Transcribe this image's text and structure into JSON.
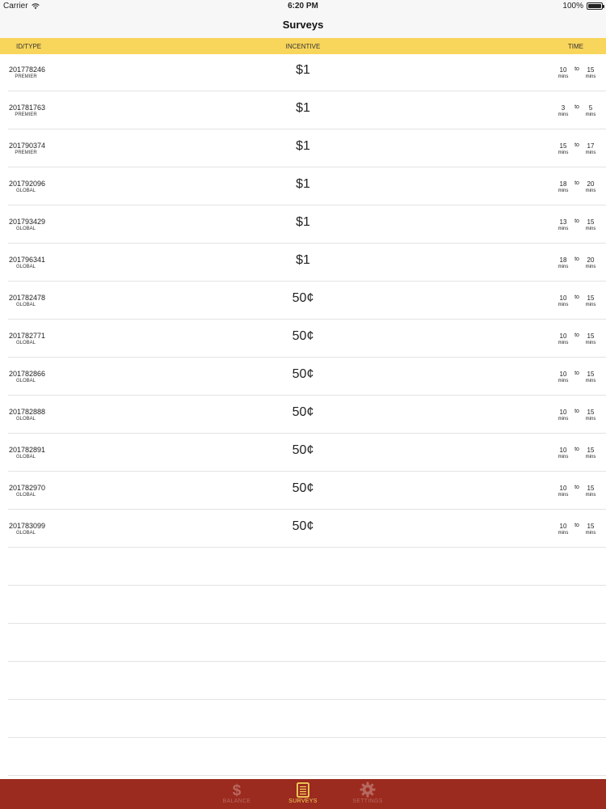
{
  "status_bar": {
    "carrier": "Carrier",
    "time": "6:20 PM",
    "battery": "100%"
  },
  "nav": {
    "title": "Surveys"
  },
  "columns": {
    "id_type": "ID/TYPE",
    "incentive": "INCENTIVE",
    "time": "TIME"
  },
  "surveys": [
    {
      "id": "201778246",
      "type": "PREMIER",
      "incentive": "$1",
      "time_from": "10",
      "time_to": "15",
      "to_label": "to",
      "unit": "mins"
    },
    {
      "id": "201781763",
      "type": "PREMIER",
      "incentive": "$1",
      "time_from": "3",
      "time_to": "5",
      "to_label": "to",
      "unit": "mins"
    },
    {
      "id": "201790374",
      "type": "PREMIER",
      "incentive": "$1",
      "time_from": "15",
      "time_to": "17",
      "to_label": "to",
      "unit": "mins"
    },
    {
      "id": "201792096",
      "type": "GLOBAL",
      "incentive": "$1",
      "time_from": "18",
      "time_to": "20",
      "to_label": "to",
      "unit": "mins"
    },
    {
      "id": "201793429",
      "type": "GLOBAL",
      "incentive": "$1",
      "time_from": "13",
      "time_to": "15",
      "to_label": "to",
      "unit": "mins"
    },
    {
      "id": "201796341",
      "type": "GLOBAL",
      "incentive": "$1",
      "time_from": "18",
      "time_to": "20",
      "to_label": "to",
      "unit": "mins"
    },
    {
      "id": "201782478",
      "type": "GLOBAL",
      "incentive": "50¢",
      "time_from": "10",
      "time_to": "15",
      "to_label": "to",
      "unit": "mins"
    },
    {
      "id": "201782771",
      "type": "GLOBAL",
      "incentive": "50¢",
      "time_from": "10",
      "time_to": "15",
      "to_label": "to",
      "unit": "mins"
    },
    {
      "id": "201782866",
      "type": "GLOBAL",
      "incentive": "50¢",
      "time_from": "10",
      "time_to": "15",
      "to_label": "to",
      "unit": "mins"
    },
    {
      "id": "201782888",
      "type": "GLOBAL",
      "incentive": "50¢",
      "time_from": "10",
      "time_to": "15",
      "to_label": "to",
      "unit": "mins"
    },
    {
      "id": "201782891",
      "type": "GLOBAL",
      "incentive": "50¢",
      "time_from": "10",
      "time_to": "15",
      "to_label": "to",
      "unit": "mins"
    },
    {
      "id": "201782970",
      "type": "GLOBAL",
      "incentive": "50¢",
      "time_from": "10",
      "time_to": "15",
      "to_label": "to",
      "unit": "mins"
    },
    {
      "id": "201783099",
      "type": "GLOBAL",
      "incentive": "50¢",
      "time_from": "10",
      "time_to": "15",
      "to_label": "to",
      "unit": "mins"
    }
  ],
  "tabs": [
    {
      "label": "BALANCE",
      "icon": "dollar-icon",
      "active": false
    },
    {
      "label": "SURVEYS",
      "icon": "document-list-icon",
      "active": true
    },
    {
      "label": "SETTINGS",
      "icon": "gear-icon",
      "active": false
    }
  ],
  "colors": {
    "header_yellow": "#f8d55b",
    "tab_bar_red": "#9b2a1f",
    "active_tab": "#f8d55b",
    "inactive_tab": "#b8685e"
  }
}
